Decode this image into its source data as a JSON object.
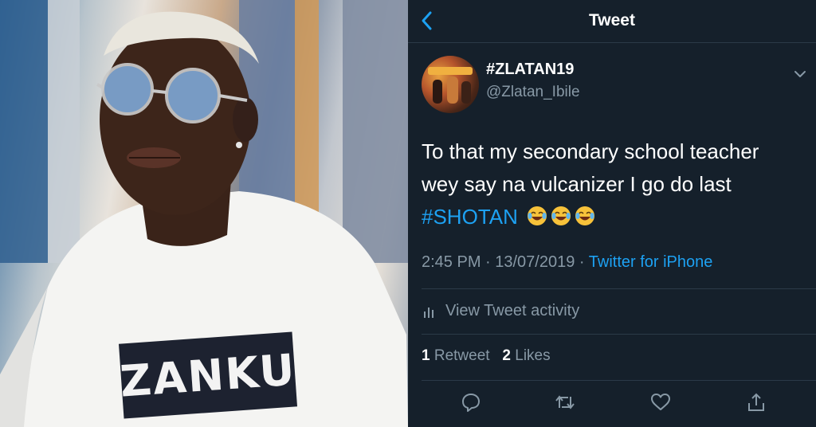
{
  "photo": {
    "shirt_text": "ZANKU"
  },
  "header": {
    "back_icon": "chevron-left-icon",
    "title": "Tweet"
  },
  "author": {
    "display_name": "#ZLATAN19",
    "handle": "@Zlatan_Ibile"
  },
  "tweet": {
    "line1": "To that my secondary school teacher",
    "line2": "wey say na vulcanizer I go do last",
    "hashtag": "#SHOTAN",
    "emoji": [
      "tears-of-joy",
      "tears-of-joy",
      "tears-of-joy"
    ],
    "timestamp": "2:45 PM · 13/07/2019 · ",
    "source": "Twitter for iPhone"
  },
  "activity": {
    "label": "View Tweet activity"
  },
  "stats": {
    "retweets_count": "1",
    "retweets_label": "Retweet",
    "likes_count": "2",
    "likes_label": "Likes"
  },
  "actions": {
    "icons": [
      "reply-icon",
      "retweet-icon",
      "like-icon",
      "share-icon"
    ]
  },
  "colors": {
    "background": "#15202b",
    "accent": "#1da1f2",
    "muted": "#8899a6",
    "divider": "#2b3a48"
  }
}
